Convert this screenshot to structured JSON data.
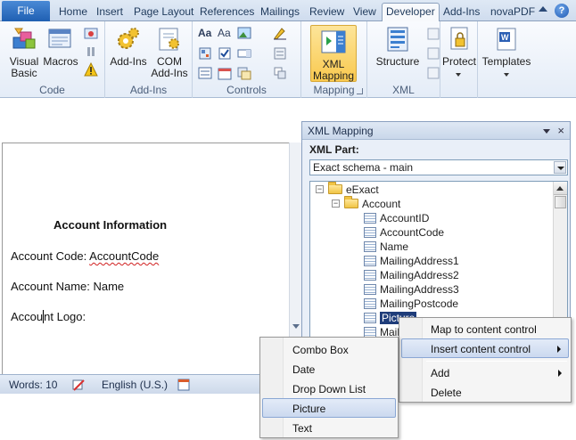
{
  "ribbon": {
    "tabs": [
      "File",
      "Home",
      "Insert",
      "Page Layout",
      "References",
      "Mailings",
      "Review",
      "View",
      "Developer",
      "Add-Ins",
      "novaPDF"
    ],
    "active_tab": "Developer",
    "groups": {
      "code": {
        "label": "Code",
        "visual_basic": "Visual\nBasic",
        "visual_basic_l1": "Visual",
        "visual_basic_l2": "Basic",
        "macros": "Macros"
      },
      "addins": {
        "label": "Add-Ins",
        "addins_btn": "Add-Ins",
        "com_l1": "COM",
        "com_l2": "Add-Ins"
      },
      "controls": {
        "label": "Controls"
      },
      "mapping": {
        "label": "Mapping",
        "xml_l1": "XML",
        "xml_l2": "Mapping"
      },
      "xml": {
        "label": "XML",
        "structure": "Structure"
      },
      "protect": {
        "label": "Protect"
      },
      "templates": {
        "label": "Templates"
      }
    },
    "help": "?"
  },
  "document": {
    "heading": "Account Information",
    "line1_prefix": "Account Code: ",
    "line1_field": "AccountCode",
    "line2": "Account Name: Name",
    "line3_a": "Accou",
    "line3_b": "nt Logo:"
  },
  "statusbar": {
    "words": "Words: 10",
    "language": "English (U.S.)"
  },
  "xml_pane": {
    "title": "XML Mapping",
    "close": "×",
    "part_label": "XML Part:",
    "part_value": "Exact schema - main",
    "tree": {
      "root": "eExact",
      "account": "Account",
      "children": [
        "AccountID",
        "AccountCode",
        "Name",
        "MailingAddress1",
        "MailingAddress2",
        "MailingAddress3",
        "MailingPostcode",
        "Picture",
        "Mail"
      ]
    }
  },
  "context_menu": {
    "items": [
      "Map to content control",
      "Insert content control",
      "Add",
      "Delete"
    ],
    "highlighted": "Insert content control"
  },
  "submenu": {
    "items": [
      "Combo Box",
      "Date",
      "Drop Down List",
      "Picture",
      "Text"
    ],
    "highlighted": "Picture"
  },
  "colors": {
    "file_tab": "#1f5fb2",
    "selected_node": "#1f3d7a",
    "xml_mapping_button": "#f9c94f"
  }
}
